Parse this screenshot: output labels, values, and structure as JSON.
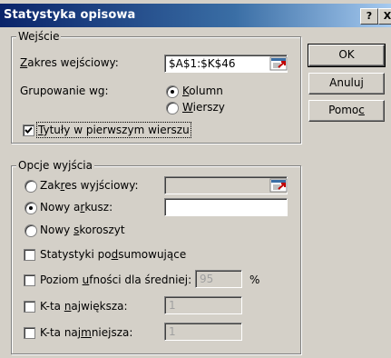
{
  "window": {
    "title": "Statystyka opisowa",
    "help_label": "?",
    "close_label": "X"
  },
  "input_group": {
    "legend": "Wejście",
    "range_label_pre": "",
    "range_label_u": "Z",
    "range_label_post": "akres wejściowy:",
    "range_value": "$A$1:$K$46",
    "grouping_label": "Grupowanie wg:",
    "columns_u": "K",
    "columns_rest": "olumn",
    "rows_u": "W",
    "rows_rest": "ierszy",
    "grouping_selected": "Kolumn",
    "labels_first_row_u": "T",
    "labels_first_row_rest": "ytuły w pierwszym wierszu",
    "labels_first_row_checked": true
  },
  "output_group": {
    "legend": "Opcje wyjścia",
    "output_range_pre": "Zak",
    "output_range_u": "r",
    "output_range_post": "es wyjściowy:",
    "new_sheet_pre": "Nowy a",
    "new_sheet_u": "r",
    "new_sheet_post": "kusz:",
    "new_workbook_pre": "Nowy ",
    "new_workbook_u": "s",
    "new_workbook_post": "koroszyt",
    "selected": "Nowy arkusz:",
    "summary_pre": "Statystyki po",
    "summary_u": "d",
    "summary_post": "sumowujące",
    "confidence_pre": "Poziom ",
    "confidence_u": "u",
    "confidence_post": "fności dla średniej:",
    "confidence_value": "95",
    "confidence_unit": "%",
    "kth_largest_pre": "K-ta ",
    "kth_largest_u": "n",
    "kth_largest_post": "ajwiększa:",
    "kth_largest_value": "1",
    "kth_smallest_pre": "K-ta naj",
    "kth_smallest_u": "m",
    "kth_smallest_post": "niejsza:",
    "kth_smallest_value": "1"
  },
  "buttons": {
    "ok": "OK",
    "cancel": "Anuluj",
    "help_pre": "Pomo",
    "help_u": "c"
  },
  "colors": {
    "title_gradient_start": "#0a246a",
    "title_gradient_end": "#a6caf0",
    "dialog_face": "#d4d0c8"
  }
}
